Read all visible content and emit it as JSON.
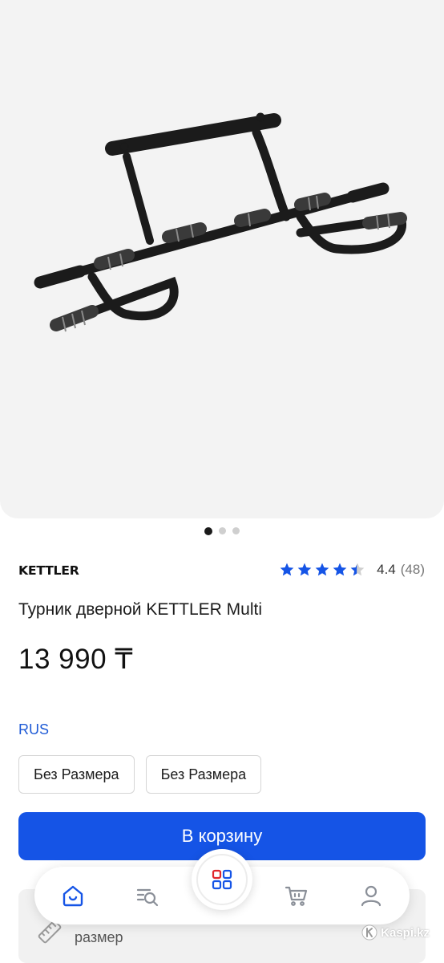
{
  "gallery": {
    "image_alt": "Турник дверной KETTLER Multi",
    "page_count": 3,
    "active_page": 1
  },
  "product": {
    "brand": "KETTLER",
    "title": "Турник дверной KETTLER Multi",
    "price": "13 990 ₸",
    "rating": {
      "value": "4.4",
      "count": "(48)",
      "stars_filled": 4.4,
      "stars_total": 5,
      "star_color": "#1554e6"
    }
  },
  "sizes": {
    "system_label": "RUS",
    "options": [
      "Без Размера",
      "Без Размера"
    ]
  },
  "actions": {
    "add_to_cart_label": "В корзину"
  },
  "size_guide": {
    "label": "размер",
    "icon": "ruler-icon"
  },
  "bottom_nav": {
    "items": [
      {
        "icon": "home-icon",
        "active": true
      },
      {
        "icon": "search-catalog-icon",
        "active": false
      },
      {
        "icon": "apps-grid-icon",
        "active": false
      },
      {
        "icon": "cart-icon",
        "active": false
      },
      {
        "icon": "profile-icon",
        "active": false
      }
    ],
    "active_color": "#1554e6",
    "inactive_color": "#8a8f98"
  },
  "watermark": {
    "text": "Kaspi.kz"
  },
  "colors": {
    "accent": "#1554e6",
    "grid_red": "#e0262b"
  }
}
